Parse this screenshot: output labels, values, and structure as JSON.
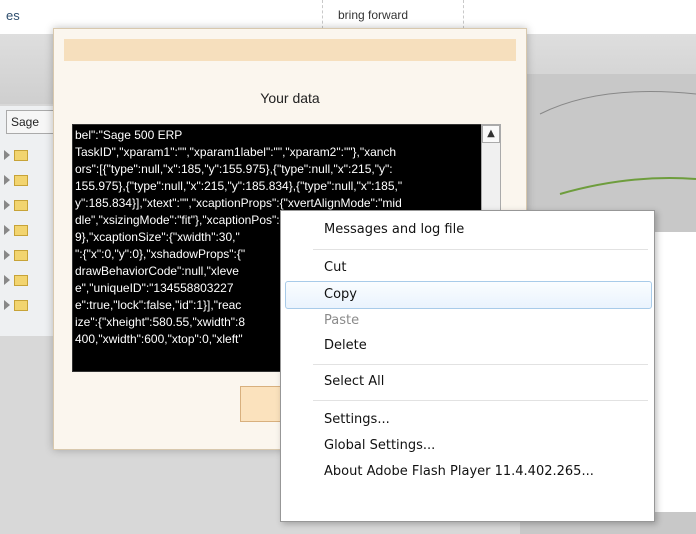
{
  "background": {
    "top_left_text": "es",
    "bring_forward": "bring forward",
    "sage_tab": "Sage"
  },
  "dialog": {
    "title": "Your data",
    "textarea_lines": [
      "bel\":\"Sage 500 ERP",
      "TaskID\",\"xparam1\":\"\",\"xparam1label\":\"\",\"xparam2\":\"\"},\"xanch",
      "ors\":[{\"type\":null,\"x\":185,\"y\":155.975},{\"type\":null,\"x\":215,\"y\":",
      "155.975},{\"type\":null,\"x\":215,\"y\":185.834},{\"type\":null,\"x\":185,\"",
      "y\":185.834}],\"xtext\":\"\",\"xcaptionProps\":{\"xvertAlignMode\":\"mid",
      "dle\",\"xsizingMode\":\"fit\"},\"xcaptionPos\":{\"xleft\":185,\"xtop\":168.",
      "9},\"xcaptionSize\":{\"xwidth\":30,\"",
      "\":{\"x\":0,\"y\":0},\"xshadowProps\":{\"",
      "drawBehaviorCode\":null,\"xleve",
      "e\",\"uniqueID\":\"134558803227",
      "e\":true,\"lock\":false,\"id\":1}],\"reac",
      "ize\":{\"xheight\":580.55,\"xwidth\":8",
      "400,\"xwidth\":600,\"xtop\":0,\"xleft\""
    ]
  },
  "context_menu": {
    "items": [
      {
        "label": "Messages and log file",
        "enabled": true
      },
      {
        "label": "Cut",
        "enabled": true
      },
      {
        "label": "Copy",
        "enabled": true,
        "highlighted": true
      },
      {
        "label": "Paste",
        "enabled": false
      },
      {
        "label": "Delete",
        "enabled": true
      },
      {
        "label": "Select All",
        "enabled": true
      },
      {
        "label": "Settings...",
        "enabled": true
      },
      {
        "label": "Global Settings...",
        "enabled": true
      },
      {
        "label": "About Adobe Flash Player 11.4.402.265...",
        "enabled": true
      }
    ]
  }
}
